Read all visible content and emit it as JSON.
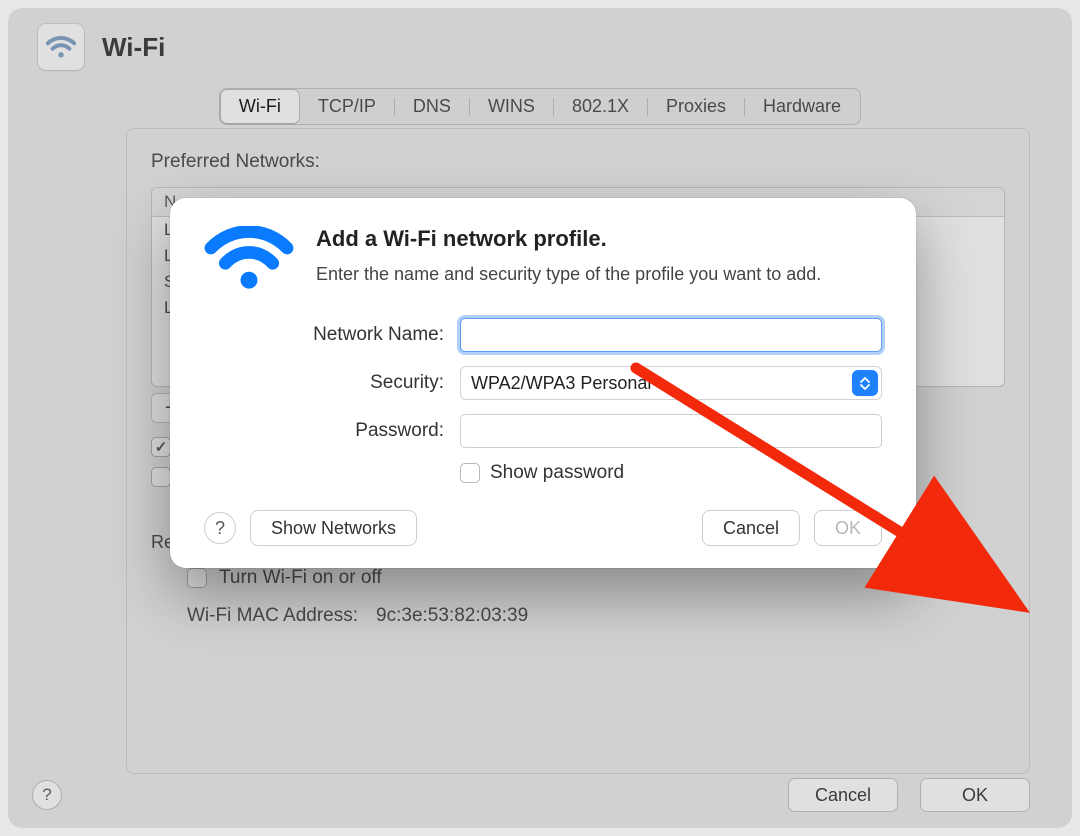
{
  "page": {
    "title": "Wi-Fi",
    "tabs": [
      "Wi-Fi",
      "TCP/IP",
      "DNS",
      "WINS",
      "802.1X",
      "Proxies",
      "Hardware"
    ],
    "active_tab_index": 0,
    "preferred_networks_label": "Preferred Networks:",
    "table_header": "N",
    "rows": [
      "L",
      "L",
      "S",
      "L"
    ],
    "add_label": "+",
    "remove_label": "−",
    "autojoin_label": "",
    "admin_label": "Re",
    "turn_wifi_label": "Turn Wi-Fi on or off",
    "mac_label": "Wi-Fi MAC Address:",
    "mac_value": "9c:3e:53:82:03:39",
    "footer_cancel": "Cancel",
    "footer_ok": "OK"
  },
  "sheet": {
    "title": "Add a Wi-Fi network profile.",
    "subtitle": "Enter the name and security type of the profile you want to add.",
    "name_label": "Network Name:",
    "name_value": "",
    "security_label": "Security:",
    "security_value": "WPA2/WPA3 Personal",
    "password_label": "Password:",
    "password_value": "",
    "show_password_label": "Show password",
    "help_label": "?",
    "show_networks_label": "Show Networks",
    "cancel_label": "Cancel",
    "ok_label": "OK"
  }
}
